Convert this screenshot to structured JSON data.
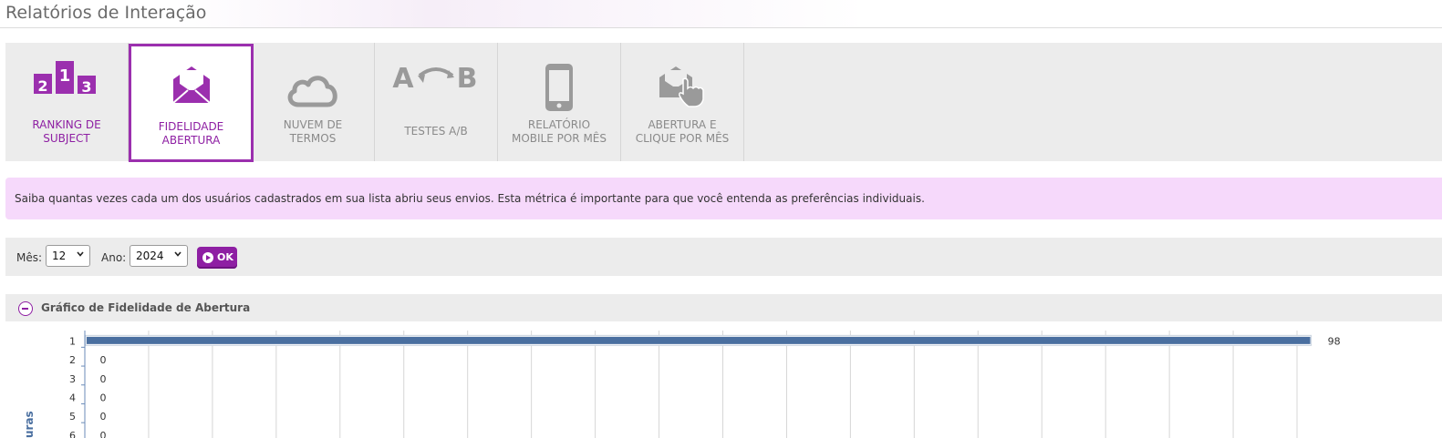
{
  "page": {
    "title": "Relatórios de Interação"
  },
  "tabs": [
    {
      "label": "RANKING DE\nSUBJECT",
      "icon": "ranking-podium-icon",
      "active": false,
      "color": "purple"
    },
    {
      "label": "FIDELIDADE\nABERTURA",
      "icon": "open-envelope-icon",
      "active": true,
      "color": "purple"
    },
    {
      "label": "NUVEM DE\nTERMOS",
      "icon": "cloud-icon",
      "active": false,
      "color": "gray"
    },
    {
      "label": "TESTES A/B",
      "icon": "ab-test-icon",
      "active": false,
      "color": "gray"
    },
    {
      "label": "RELATÓRIO\nMOBILE POR MÊS",
      "icon": "mobile-phone-icon",
      "active": false,
      "color": "gray"
    },
    {
      "label": "ABERTURA E\nCLIQUE POR MÊS",
      "icon": "envelope-click-icon",
      "active": false,
      "color": "gray"
    }
  ],
  "icons": {
    "podium": [
      "2",
      "1",
      "3"
    ],
    "ab": [
      "A",
      "B"
    ]
  },
  "info": {
    "text": "Saiba quantas vezes cada um dos usuários cadastrados em sua lista abriu seus envios. Esta métrica é importante para que você entenda as preferências individuais."
  },
  "filters": {
    "month_label": "Mês:",
    "month_value": "12",
    "year_label": "Ano:",
    "year_value": "2024",
    "ok_label": "OK"
  },
  "section": {
    "title": "Gráfico de Fidelidade de Abertura"
  },
  "colors": {
    "accent": "#8e1fa3",
    "bar": "#4a6fa0",
    "info_bg": "#f6d9fb"
  },
  "chart_data": {
    "type": "bar",
    "orientation": "horizontal",
    "categories": [
      "1",
      "2",
      "3",
      "4",
      "5",
      "6"
    ],
    "values": [
      98,
      0,
      0,
      0,
      0,
      0
    ],
    "value_labels": [
      "98",
      "0",
      "0",
      "0",
      "0",
      "0"
    ],
    "ylabel": "uras",
    "xlim": [
      0,
      100
    ],
    "grid": true
  }
}
